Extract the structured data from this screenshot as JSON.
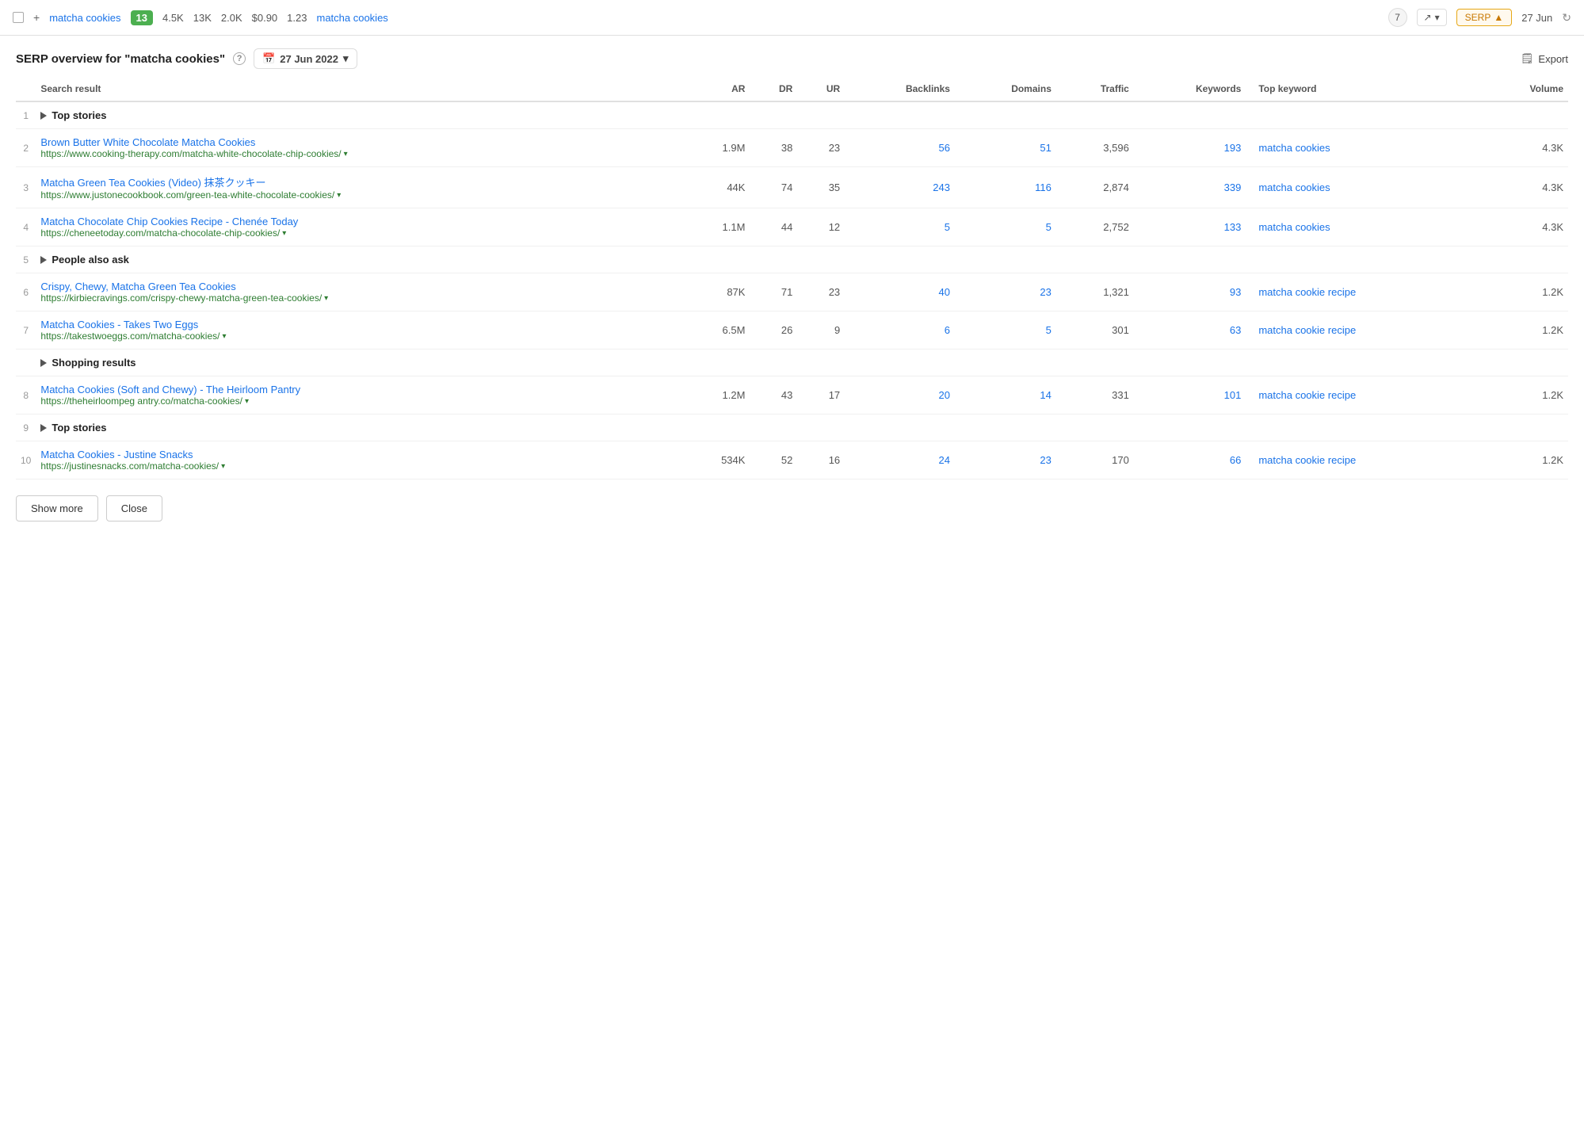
{
  "topbar": {
    "keyword": "matcha cookies",
    "badge": "13",
    "stats": [
      "4.5K",
      "13K",
      "2.0K",
      "$0.90",
      "1.23"
    ],
    "keyword2": "matcha cookies",
    "number": "7",
    "serp_label": "SERP",
    "date": "27 Jun"
  },
  "header": {
    "title": "SERP overview for \"matcha cookies\"",
    "help": "?",
    "date_selector": "27 Jun 2022",
    "export": "Export"
  },
  "table": {
    "columns": {
      "search_result": "Search result",
      "ar": "AR",
      "dr": "DR",
      "ur": "UR",
      "backlinks": "Backlinks",
      "domains": "Domains",
      "traffic": "Traffic",
      "keywords": "Keywords",
      "top_keyword": "Top keyword",
      "volume": "Volume"
    },
    "rows": [
      {
        "num": "1",
        "type": "special",
        "label": "Top stories",
        "ar": "",
        "dr": "",
        "ur": "",
        "backlinks": "",
        "domains": "",
        "traffic": "",
        "keywords": "",
        "top_keyword": "",
        "volume": ""
      },
      {
        "num": "2",
        "type": "result",
        "title": "Brown Butter White Chocolate Matcha Cookies",
        "url": "https://www.cooking-therapy.com/matcha-white-chocolate-chip-cookies/",
        "ar": "1.9M",
        "dr": "38",
        "ur": "23",
        "backlinks": "56",
        "domains": "51",
        "traffic": "3,596",
        "keywords": "193",
        "top_keyword": "matcha cookies",
        "volume": "4.3K"
      },
      {
        "num": "3",
        "type": "result",
        "title": "Matcha Green Tea Cookies (Video) 抹茶クッキー",
        "url": "https://www.justonecookbook.com/green-tea-white-chocolate-cookies/",
        "ar": "44K",
        "dr": "74",
        "ur": "35",
        "backlinks": "243",
        "domains": "116",
        "traffic": "2,874",
        "keywords": "339",
        "top_keyword": "matcha cookies",
        "volume": "4.3K"
      },
      {
        "num": "4",
        "type": "result",
        "title": "Matcha Chocolate Chip Cookies Recipe - Chenée Today",
        "url": "https://cheneetoday.com/matcha-chocolate-chip-cookies/",
        "ar": "1.1M",
        "dr": "44",
        "ur": "12",
        "backlinks": "5",
        "domains": "5",
        "traffic": "2,752",
        "keywords": "133",
        "top_keyword": "matcha cookies",
        "volume": "4.3K"
      },
      {
        "num": "5",
        "type": "special",
        "label": "People also ask",
        "ar": "",
        "dr": "",
        "ur": "",
        "backlinks": "",
        "domains": "",
        "traffic": "",
        "keywords": "",
        "top_keyword": "",
        "volume": ""
      },
      {
        "num": "6",
        "type": "result",
        "title": "Crispy, Chewy, Matcha Green Tea Cookies",
        "url": "https://kirbiecravings.com/crispy-chewy-matcha-green-tea-cookies/",
        "ar": "87K",
        "dr": "71",
        "ur": "23",
        "backlinks": "40",
        "domains": "23",
        "traffic": "1,321",
        "keywords": "93",
        "top_keyword": "matcha cookie recipe",
        "volume": "1.2K"
      },
      {
        "num": "7",
        "type": "result",
        "title": "Matcha Cookies - Takes Two Eggs",
        "url": "https://takestwoeggs.com/matcha-cookies/",
        "ar": "6.5M",
        "dr": "26",
        "ur": "9",
        "backlinks": "6",
        "domains": "5",
        "traffic": "301",
        "keywords": "63",
        "top_keyword": "matcha cookie recipe",
        "volume": "1.2K"
      },
      {
        "num": "",
        "type": "special",
        "label": "Shopping results",
        "ar": "",
        "dr": "",
        "ur": "",
        "backlinks": "",
        "domains": "",
        "traffic": "",
        "keywords": "",
        "top_keyword": "",
        "volume": ""
      },
      {
        "num": "8",
        "type": "result",
        "title": "Matcha Cookies (Soft and Chewy) - The Heirloom Pantry",
        "url": "https://theheirloompeg antry.co/matcha-cookies/",
        "ar": "1.2M",
        "dr": "43",
        "ur": "17",
        "backlinks": "20",
        "domains": "14",
        "traffic": "331",
        "keywords": "101",
        "top_keyword": "matcha cookie recipe",
        "volume": "1.2K"
      },
      {
        "num": "9",
        "type": "special",
        "label": "Top stories",
        "ar": "",
        "dr": "",
        "ur": "",
        "backlinks": "",
        "domains": "",
        "traffic": "",
        "keywords": "",
        "top_keyword": "",
        "volume": ""
      },
      {
        "num": "10",
        "type": "result",
        "title": "Matcha Cookies - Justine Snacks",
        "url": "https://justinesnacks.com/matcha-cookies/",
        "ar": "534K",
        "dr": "52",
        "ur": "16",
        "backlinks": "24",
        "domains": "23",
        "traffic": "170",
        "keywords": "66",
        "top_keyword": "matcha cookie recipe",
        "volume": "1.2K"
      }
    ]
  },
  "buttons": {
    "show_more": "Show more",
    "close": "Close"
  }
}
